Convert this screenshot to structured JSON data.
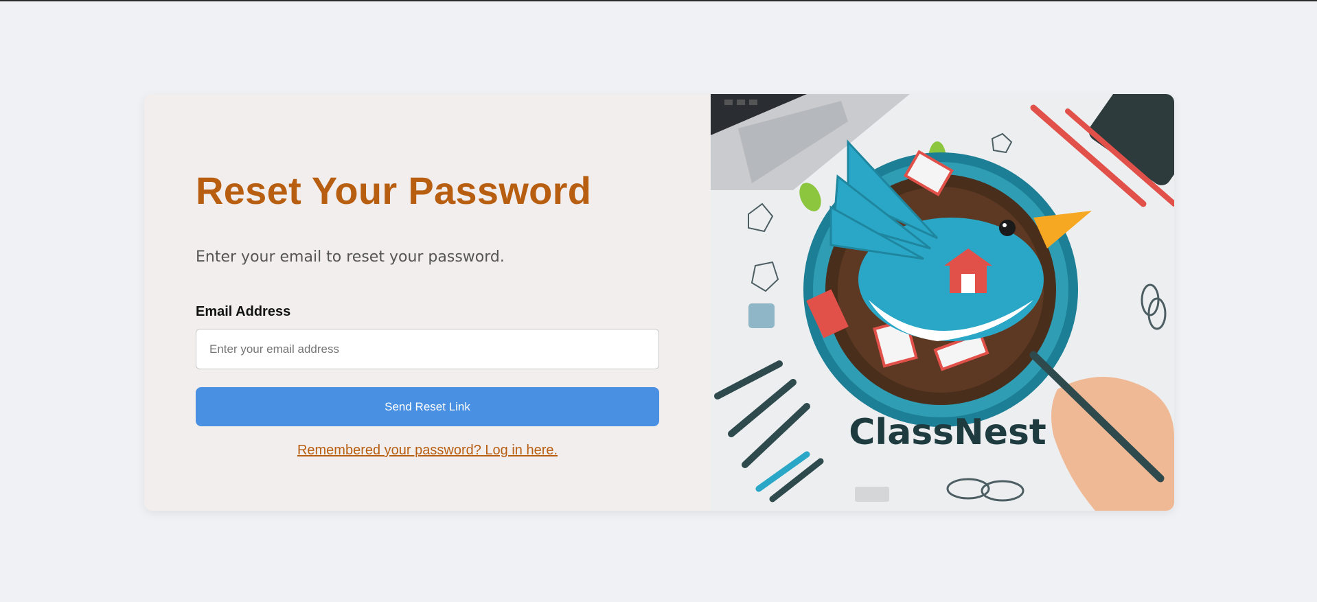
{
  "form": {
    "title": "Reset Your Password",
    "subtitle": "Enter your email to reset your password.",
    "email_label": "Email Address",
    "email_placeholder": "Enter your email address",
    "email_value": "",
    "submit_label": "Send Reset Link",
    "login_link": "Remembered your password? Log in here."
  },
  "illustration": {
    "logo_text": "ClassNest"
  },
  "colors": {
    "accent": "#b85e10",
    "button": "#4a90e2",
    "page_bg": "#f0f1f5",
    "card_bg": "#f2eeee"
  }
}
